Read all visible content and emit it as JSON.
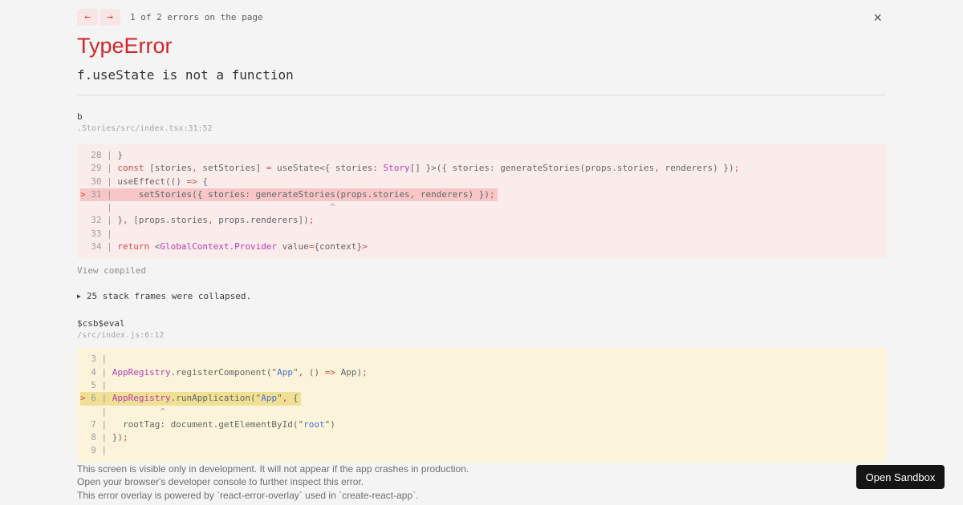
{
  "header": {
    "prev_icon": "←",
    "next_icon": "→",
    "counter": "1 of 2 errors on the page",
    "close_icon": "×"
  },
  "error": {
    "type": "TypeError",
    "message": "f.useState is not a function"
  },
  "collapsed": {
    "icon": "▶",
    "text": "25 stack frames were collapsed."
  },
  "frames": [
    {
      "fn": "b",
      "location": ".Stories/src/index.tsx:31:52",
      "view_compiled": "View compiled"
    },
    {
      "fn": "$csb$eval",
      "location": "/src/index.js:6:12"
    }
  ],
  "code_blocks": [
    {
      "theme": "error",
      "lines": [
        {
          "highlight": false,
          "tokens": [
            {
              "t": "  28 | ",
              "c": "g"
            },
            {
              "t": "}",
              "c": "p"
            }
          ]
        },
        {
          "highlight": false,
          "tokens": [
            {
              "t": "  29 | ",
              "c": "g"
            },
            {
              "t": "const",
              "c": "k"
            },
            {
              "t": " [stories",
              "c": "p"
            },
            {
              "t": ",",
              "c": "k"
            },
            {
              "t": " setStories] ",
              "c": "p"
            },
            {
              "t": "=",
              "c": "k"
            },
            {
              "t": " useState<{ stories: ",
              "c": "p"
            },
            {
              "t": "Story",
              "c": "m"
            },
            {
              "t": "[] }>({ stories: generateStories(props.stories",
              "c": "p"
            },
            {
              "t": ",",
              "c": "k"
            },
            {
              "t": " renderers) })",
              "c": "p"
            },
            {
              "t": ";",
              "c": "k"
            }
          ]
        },
        {
          "highlight": false,
          "tokens": [
            {
              "t": "  30 | ",
              "c": "g"
            },
            {
              "t": "useEffect(() ",
              "c": "p"
            },
            {
              "t": "=>",
              "c": "k"
            },
            {
              "t": " {",
              "c": "p"
            }
          ]
        },
        {
          "highlight": true,
          "tokens": [
            {
              "t": "> ",
              "c": "k"
            },
            {
              "t": "31 | ",
              "c": "g"
            },
            {
              "t": "    setStories({ stories: generateStories(props.stories",
              "c": "p"
            },
            {
              "t": ",",
              "c": "k"
            },
            {
              "t": " renderers) })",
              "c": "p"
            },
            {
              "t": ";",
              "c": "k"
            }
          ]
        },
        {
          "highlight": false,
          "tokens": [
            {
              "t": "     |",
              "c": "g"
            },
            {
              "t": "                                         ",
              "c": "g"
            },
            {
              "t": "^",
              "c": "c"
            }
          ]
        },
        {
          "highlight": false,
          "tokens": [
            {
              "t": "  32 | ",
              "c": "g"
            },
            {
              "t": "}",
              "c": "p"
            },
            {
              "t": ",",
              "c": "k"
            },
            {
              "t": " [props.stories",
              "c": "p"
            },
            {
              "t": ",",
              "c": "k"
            },
            {
              "t": " props.renderers])",
              "c": "p"
            },
            {
              "t": ";",
              "c": "k"
            }
          ]
        },
        {
          "highlight": false,
          "tokens": [
            {
              "t": "  33 |",
              "c": "g"
            }
          ]
        },
        {
          "highlight": false,
          "tokens": [
            {
              "t": "  34 | ",
              "c": "g"
            },
            {
              "t": "return",
              "c": "k"
            },
            {
              "t": " <",
              "c": "p"
            },
            {
              "t": "GlobalContext.Provider",
              "c": "m"
            },
            {
              "t": " value",
              "c": "p"
            },
            {
              "t": "=",
              "c": "k"
            },
            {
              "t": "{context}",
              "c": "p"
            },
            {
              "t": ">",
              "c": "k"
            }
          ]
        }
      ]
    },
    {
      "theme": "warning",
      "lines": [
        {
          "highlight": false,
          "tokens": [
            {
              "t": "  3 |",
              "c": "g"
            }
          ]
        },
        {
          "highlight": false,
          "tokens": [
            {
              "t": "  4 | ",
              "c": "g"
            },
            {
              "t": "AppRegistry",
              "c": "m"
            },
            {
              "t": ".registerComponent(",
              "c": "p"
            },
            {
              "t": "\"",
              "c": "p"
            },
            {
              "t": "App",
              "c": "s"
            },
            {
              "t": "\"",
              "c": "p"
            },
            {
              "t": ",",
              "c": "k"
            },
            {
              "t": " () ",
              "c": "p"
            },
            {
              "t": "=>",
              "c": "k"
            },
            {
              "t": " App)",
              "c": "p"
            },
            {
              "t": ";",
              "c": "k"
            }
          ]
        },
        {
          "highlight": false,
          "tokens": [
            {
              "t": "  5 |",
              "c": "g"
            }
          ]
        },
        {
          "highlight": true,
          "tokens": [
            {
              "t": "> ",
              "c": "k"
            },
            {
              "t": "6 | ",
              "c": "g"
            },
            {
              "t": "AppRegistry",
              "c": "m"
            },
            {
              "t": ".runApplication(",
              "c": "p"
            },
            {
              "t": "\"",
              "c": "p"
            },
            {
              "t": "App",
              "c": "s"
            },
            {
              "t": "\"",
              "c": "p"
            },
            {
              "t": ",",
              "c": "k"
            },
            {
              "t": " {",
              "c": "p"
            }
          ]
        },
        {
          "highlight": false,
          "tokens": [
            {
              "t": "    |",
              "c": "g"
            },
            {
              "t": "          ",
              "c": "g"
            },
            {
              "t": "^",
              "c": "c"
            }
          ]
        },
        {
          "highlight": false,
          "tokens": [
            {
              "t": "  7 | ",
              "c": "g"
            },
            {
              "t": "  rootTag: document.getElementById(",
              "c": "p"
            },
            {
              "t": "\"",
              "c": "p"
            },
            {
              "t": "root",
              "c": "s"
            },
            {
              "t": "\"",
              "c": "p"
            },
            {
              "t": ")",
              "c": "p"
            }
          ]
        },
        {
          "highlight": false,
          "tokens": [
            {
              "t": "  8 | ",
              "c": "g"
            },
            {
              "t": "})",
              "c": "p"
            },
            {
              "t": ";",
              "c": "k"
            }
          ]
        },
        {
          "highlight": false,
          "tokens": [
            {
              "t": "  9 |",
              "c": "g"
            }
          ]
        }
      ]
    }
  ],
  "footer": {
    "lines": [
      "This screen is visible only in development. It will not appear if the app crashes in production.",
      "Open your browser's developer console to further inspect this error.",
      "This error overlay is powered by `react-error-overlay` used in `create-react-app`."
    ],
    "button_label": "Open Sandbox"
  },
  "colors": {
    "page_background": "#f4f4f4",
    "error_heading": "#d0262b",
    "error_frame_background": "#fbecec",
    "error_line_highlight": "#f7c6c6",
    "warning_frame_background": "#fbf4da",
    "warning_line_highlight": "#f0e095",
    "keyword_red": "#cb4b47",
    "identifier_magenta": "#b73cb3",
    "string_blue": "#4672d3",
    "sandbox_button_background": "#151515"
  }
}
